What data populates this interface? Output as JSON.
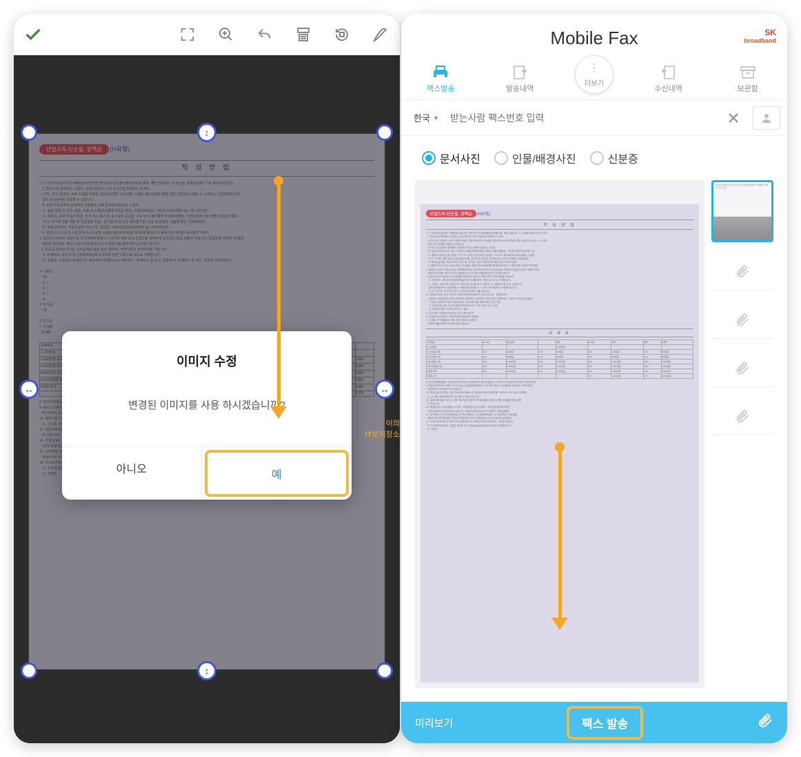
{
  "left": {
    "toolbar": {
      "confirm": "check"
    },
    "doc": {
      "badge": "단일소득-단순율, 정액급",
      "type": "(H유형)",
      "title": "작 성 방 법"
    },
    "dialog": {
      "title": "이미지 수정",
      "message": "변경된 이미지를 사용 하시겠습니까?",
      "no": "아니오",
      "yes": "예"
    },
    "watermark": {
      "line1": "이의",
      "line2": "보저장소"
    }
  },
  "right": {
    "header": {
      "title": "Mobile Fax",
      "brand_prefix": "SK",
      "brand": "broadband"
    },
    "nav": {
      "send": "팩스발송",
      "sent": "발송내역",
      "more": "더보기",
      "received": "수신내역",
      "archive": "보관함"
    },
    "recipient": {
      "country": "한국",
      "placeholder": "받는사람 팩스번호 입력"
    },
    "photo_types": {
      "doc": "문서사진",
      "person": "인물/배경사진",
      "id": "신분증"
    },
    "preview_doc": {
      "badge": "단일소득-단순율, 정액급",
      "type": "(H유형)",
      "title": "작 성 방 법"
    },
    "bottom": {
      "preview": "미리보기",
      "send": "팩스 발송"
    }
  }
}
